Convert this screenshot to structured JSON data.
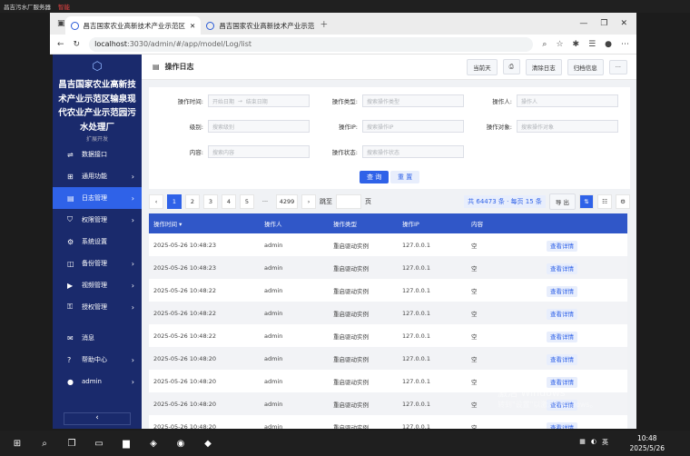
{
  "os_topbar": {
    "title": "昌吉污水厂服务器",
    "tag": "智能"
  },
  "tabs": [
    {
      "label": "昌吉国家农业高新技术产业示范区"
    },
    {
      "label": "昌吉国家农业高新技术产业示范"
    }
  ],
  "address": {
    "host": "localhost",
    "rest": ":3030/admin/#/app/model/Log/list"
  },
  "sidebar": {
    "title": "昌吉国家农业高新技术产业示范区输泉现代农业产业示范园污水处理厂",
    "items": [
      {
        "label": "数据接口",
        "icon": "link-icon"
      },
      {
        "label": "通用功能",
        "icon": "grid-icon"
      },
      {
        "label": "日志管理",
        "icon": "doc-icon",
        "active": true
      },
      {
        "label": "权限管理",
        "icon": "shield-icon"
      },
      {
        "label": "系统设置",
        "icon": "gear-icon"
      },
      {
        "label": "备份管理",
        "icon": "backup-icon"
      },
      {
        "label": "视频管理",
        "icon": "video-icon"
      },
      {
        "label": "授权管理",
        "icon": "key-icon"
      },
      {
        "label": "消息",
        "icon": "message-icon"
      },
      {
        "label": "帮助中心",
        "icon": "help-icon"
      },
      {
        "label": "admin",
        "icon": "user-icon"
      }
    ],
    "collapse": "‹",
    "partial_item": "扩展开发"
  },
  "header": {
    "title": "操作日志",
    "today": "当前天",
    "clear": "清除日志",
    "archive": "归档信息",
    "more": "···"
  },
  "filters": {
    "time_label": "操作时间:",
    "start_ph": "开始日期",
    "sep": "→",
    "end_ph": "结束日期",
    "type_label": "操作类型:",
    "type_ph": "搜索操作类型",
    "user_label": "操作人:",
    "user_ph": "操作人",
    "level_label": "级别:",
    "level_ph": "搜索级别",
    "ip_label": "操作IP:",
    "ip_ph": "搜索操作IP",
    "target_label": "操作对象:",
    "target_ph": "搜索操作对象",
    "content_label": "内容:",
    "content_ph": "搜索内容",
    "status_label": "操作状态:",
    "status_ph": "搜索操作状态",
    "query": "查 询",
    "reset": "重 置"
  },
  "pager": {
    "pages": [
      "1",
      "2",
      "3",
      "4",
      "5"
    ],
    "ellipsis": "···",
    "last": "4299",
    "jump": "跳至",
    "page_unit": "页",
    "summary": "共 64473 条 · 每页 15 条",
    "export": "导 出"
  },
  "table": {
    "headers": [
      "操作时间 ▾",
      "操作人",
      "操作类型",
      "操作IP",
      "内容"
    ],
    "detail": "查看详情",
    "rows": [
      [
        "2025-05-26 10:48:23",
        "admin",
        "重启驱动实例",
        "127.0.0.1",
        "空"
      ],
      [
        "2025-05-26 10:48:23",
        "admin",
        "重启驱动实例",
        "127.0.0.1",
        "空"
      ],
      [
        "2025-05-26 10:48:22",
        "admin",
        "重启驱动实例",
        "127.0.0.1",
        "空"
      ],
      [
        "2025-05-26 10:48:22",
        "admin",
        "重启驱动实例",
        "127.0.0.1",
        "空"
      ],
      [
        "2025-05-26 10:48:22",
        "admin",
        "重启驱动实例",
        "127.0.0.1",
        "空"
      ],
      [
        "2025-05-26 10:48:20",
        "admin",
        "重启驱动实例",
        "127.0.0.1",
        "空"
      ],
      [
        "2025-05-26 10:48:20",
        "admin",
        "重启驱动实例",
        "127.0.0.1",
        "空"
      ],
      [
        "2025-05-26 10:48:20",
        "admin",
        "重启驱动实例",
        "127.0.0.1",
        "空"
      ],
      [
        "2025-05-26 10:48:20",
        "admin",
        "重启驱动实例",
        "127.0.0.1",
        "空"
      ]
    ]
  },
  "watermark": {
    "line1": "激活 Windows",
    "line2": "转到\"设置\"以激活 Windows。"
  },
  "taskbar": {
    "time": "10:48",
    "date": "2025/5/26",
    "lang": "英"
  },
  "colors": {
    "sidebar": "#1a2a6c",
    "accent": "#2f62e8",
    "table_header": "#3057c8"
  }
}
